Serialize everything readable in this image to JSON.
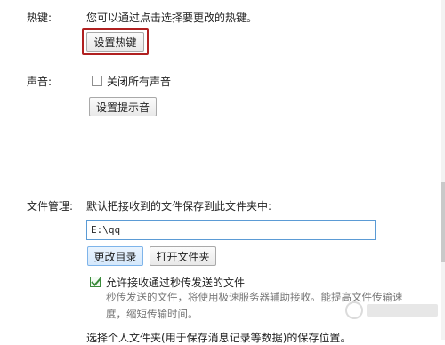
{
  "hotkey": {
    "label": "热键:",
    "hint": "您可以通过点击选择要更改的热键。",
    "button": "设置热键"
  },
  "sound": {
    "label": "声音:",
    "mute_all_label": "关闭所有声音",
    "mute_all_checked": false,
    "button": "设置提示音"
  },
  "file_management": {
    "label": "文件管理:",
    "hint": "默认把接收到的文件保存到此文件夹中:",
    "path_value": "E:\\qq",
    "change_dir_button": "更改目录",
    "open_folder_button": "打开文件夹",
    "fast_transfer_label": "允许接收通过秒传发送的文件",
    "fast_transfer_checked": true,
    "fast_transfer_desc_line1": "秒传发送的文件，将使用极速服务器辅助接收。能提高文件传输速",
    "fast_transfer_desc_line2": "度，缩短传输时间。",
    "personal_folder_hint": "选择个人文件夹(用于保存消息记录等数据)的保存位置。"
  },
  "colors": {
    "highlight_border": "#b02020",
    "checkbox_checked": "#3a8a3a",
    "input_border": "#5b9bd5"
  }
}
